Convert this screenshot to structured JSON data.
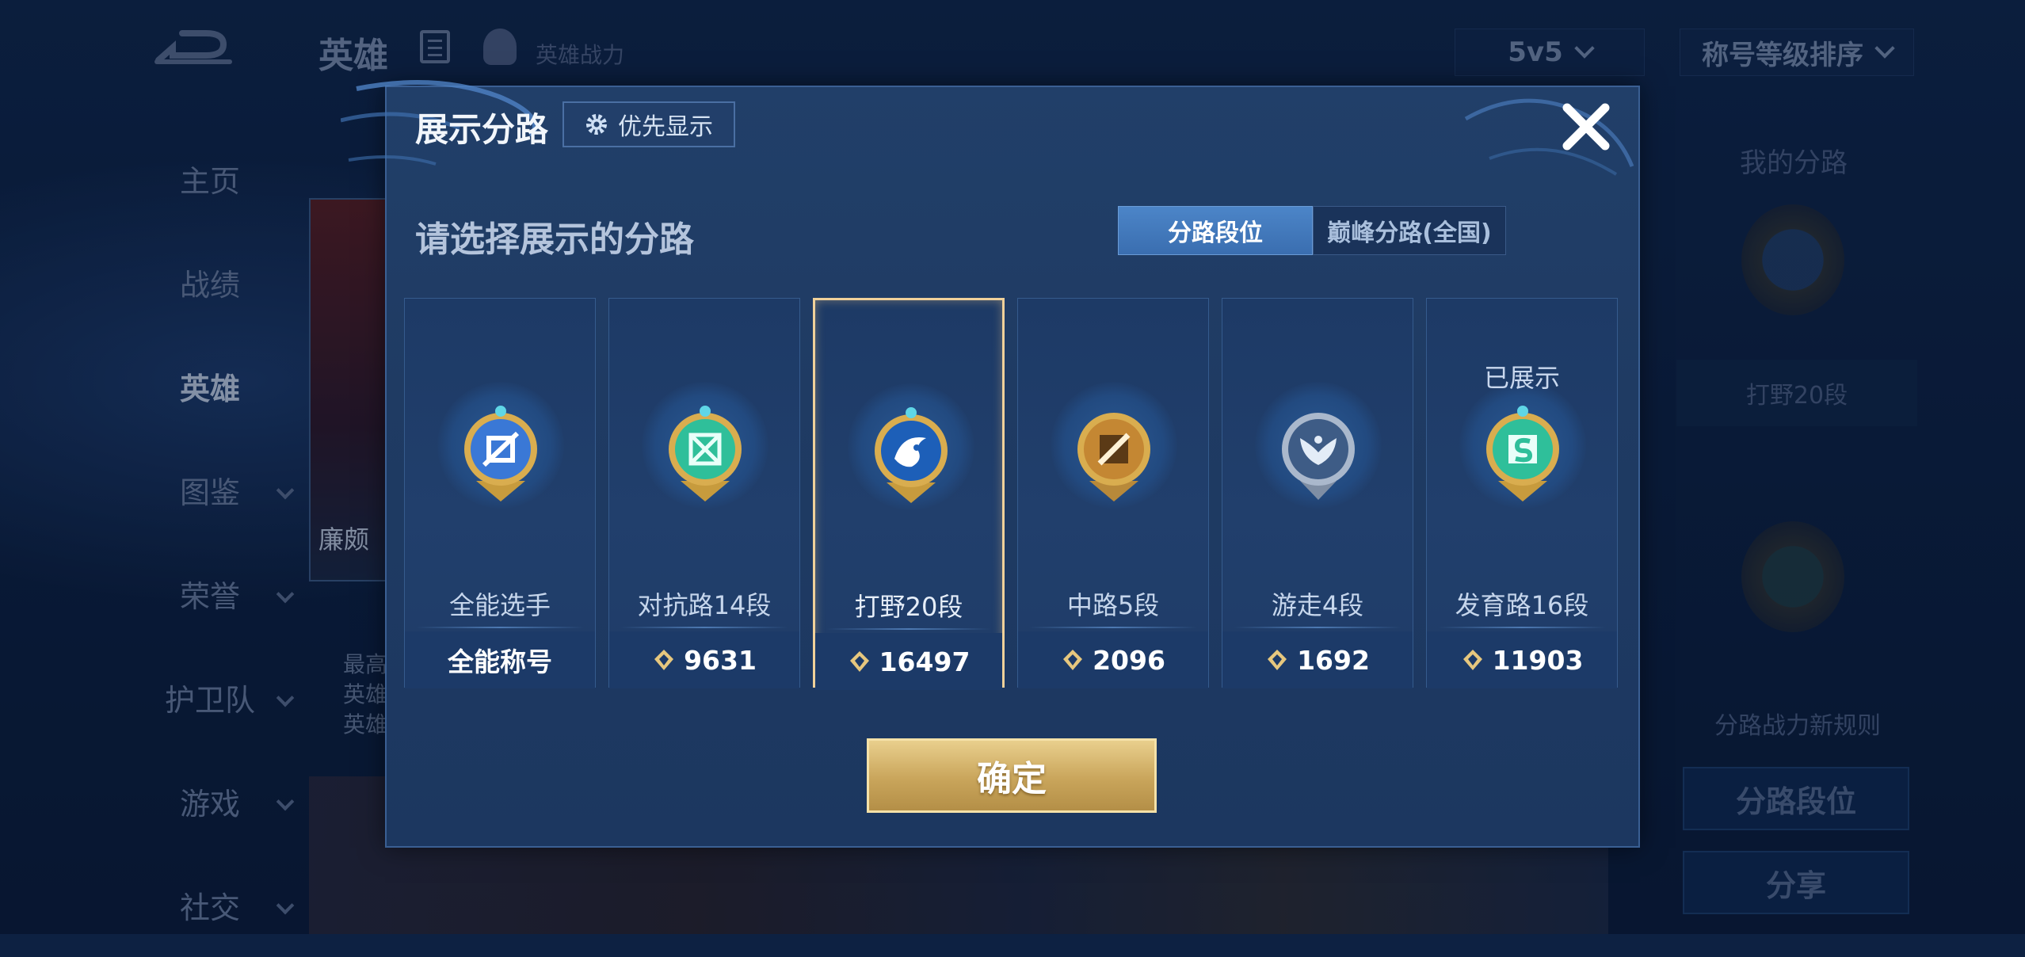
{
  "header": {
    "title": "英雄",
    "hero_power_label": "英雄战力",
    "mode_select": "5v5",
    "sort_select": "称号等级排序"
  },
  "left_nav": {
    "items": [
      {
        "label": "主页"
      },
      {
        "label": "战绩"
      },
      {
        "label": "英雄"
      },
      {
        "label": "图鉴"
      },
      {
        "label": "荣誉"
      },
      {
        "label": "护卫队"
      },
      {
        "label": "游戏"
      },
      {
        "label": "社交"
      }
    ]
  },
  "background": {
    "hero_name": "廉颇",
    "desc_lines": [
      "最高",
      "英雄",
      "英雄"
    ]
  },
  "right_panel": {
    "title": "我的分路",
    "badge_label": "打野20段",
    "rule_link": "分路战力新规则",
    "lane_button": "分路段位",
    "share_button": "分享"
  },
  "modal": {
    "title": "展示分路",
    "priority_button": "优先显示",
    "subtitle": "请选择展示的分路",
    "tabs": [
      "分路段位",
      "巅峰分路(全国)"
    ],
    "confirm_button": "确定",
    "cards": [
      {
        "name": "全能选手",
        "value": "全能称号",
        "has_power_icon": false,
        "shown": "",
        "selected": false,
        "emblem": "all-round-icon",
        "color": "#3a78d6"
      },
      {
        "name": "对抗路14段",
        "value": "9631",
        "has_power_icon": true,
        "shown": "",
        "selected": false,
        "emblem": "clash-lane-icon",
        "color": "#2fbf9a"
      },
      {
        "name": "打野20段",
        "value": "16497",
        "has_power_icon": true,
        "shown": "",
        "selected": true,
        "emblem": "jungle-dragon-icon",
        "color": "#2a6fc9"
      },
      {
        "name": "中路5段",
        "value": "2096",
        "has_power_icon": true,
        "shown": "",
        "selected": false,
        "emblem": "mid-lane-icon",
        "color": "#d49a3c"
      },
      {
        "name": "游走4段",
        "value": "1692",
        "has_power_icon": true,
        "shown": "",
        "selected": false,
        "emblem": "roam-wings-icon",
        "color": "#9fb4cf"
      },
      {
        "name": "发育路16段",
        "value": "11903",
        "has_power_icon": true,
        "shown": "已展示",
        "selected": false,
        "emblem": "farm-lane-icon",
        "color": "#2fbf9a"
      }
    ]
  }
}
